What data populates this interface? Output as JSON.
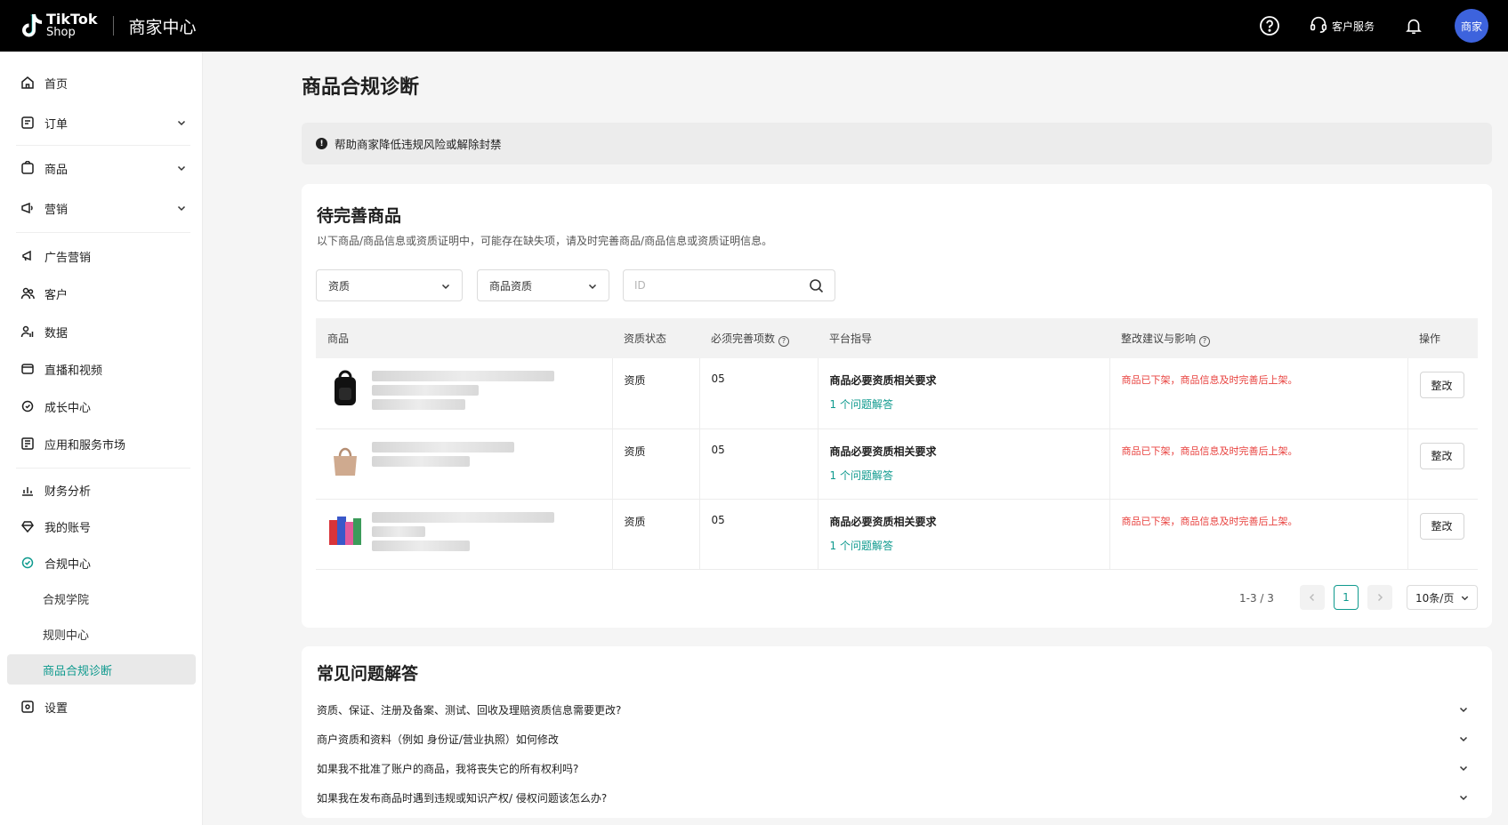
{
  "header": {
    "logo_line1": "TikTok",
    "logo_line2": "Shop",
    "portal_title": "商家中心",
    "customer_service": "客户服务",
    "avatar_text": "商家"
  },
  "sidebar": {
    "items": [
      {
        "label": "首页",
        "icon": "home-icon"
      },
      {
        "label": "订单",
        "icon": "order-icon"
      },
      {
        "label": "商品",
        "icon": "product-icon"
      },
      {
        "label": "营销",
        "icon": "marketing-icon"
      },
      {
        "label": "广告营销",
        "icon": "megaphone-icon"
      },
      {
        "label": "客户",
        "icon": "customers-icon"
      },
      {
        "label": "数据",
        "icon": "data-icon"
      },
      {
        "label": "直播和视频",
        "icon": "live-video-icon"
      },
      {
        "label": "成长中心",
        "icon": "growth-icon"
      },
      {
        "label": "应用和服务市场",
        "icon": "apps-icon"
      },
      {
        "label": "财务分析",
        "icon": "finance-icon"
      },
      {
        "label": "我的账号",
        "icon": "account-icon"
      },
      {
        "label": "合规中心",
        "icon": "compliance-icon"
      },
      {
        "label": "合规学院"
      },
      {
        "label": "规则中心"
      },
      {
        "label": "商品合规诊断"
      },
      {
        "label": "设置",
        "icon": "settings-icon"
      }
    ]
  },
  "main": {
    "title": "商品合规诊断",
    "notice": "帮助商家降低违规风险或解除封禁",
    "pending": {
      "title": "待完善商品",
      "description": "以下商品/商品信息或资质证明中，可能存在缺失项，请及时完善商品/商品信息或资质证明信息。",
      "filter1": "资质",
      "filter2": "商品资质",
      "search_placeholder": "ID",
      "columns": [
        "商品",
        "资质状态",
        "必须完善项数",
        "平台指导",
        "整改建议与影响",
        "操作"
      ],
      "rows": [
        {
          "thumb": "backpack-thumbnail",
          "status": "资质",
          "count": "05",
          "guide": "商品必要资质相关要求",
          "link": "1 个问题解答",
          "impact": "商品已下架，商品信息及时完善后上架。",
          "action": "整改"
        },
        {
          "thumb": "handbag-thumbnail",
          "status": "资质",
          "count": "05",
          "guide": "商品必要资质相关要求",
          "link": "1 个问题解答",
          "impact": "商品已下架，商品信息及时完善后上架。",
          "action": "整改"
        },
        {
          "thumb": "books-thumbnail",
          "status": "资质",
          "count": "05",
          "guide": "商品必要资质相关要求",
          "link": "1 个问题解答",
          "impact": "商品已下架，商品信息及时完善后上架。",
          "action": "整改"
        }
      ],
      "pagination": {
        "range": "1-3 / 3",
        "current": "1",
        "page_size": "10条/页"
      }
    },
    "faq": {
      "title": "常见问题解答",
      "items": [
        "资质、保证、注册及备案、测试、回收及理赔资质信息需要更改?",
        "商户资质和资料（例如 身份证/营业执照）如何修改",
        "如果我不批准了账户的商品，我将丧失它的所有权利吗?",
        "如果我在发布商品时遇到违规或知识产权/ 侵权问题该怎么办?"
      ]
    }
  }
}
